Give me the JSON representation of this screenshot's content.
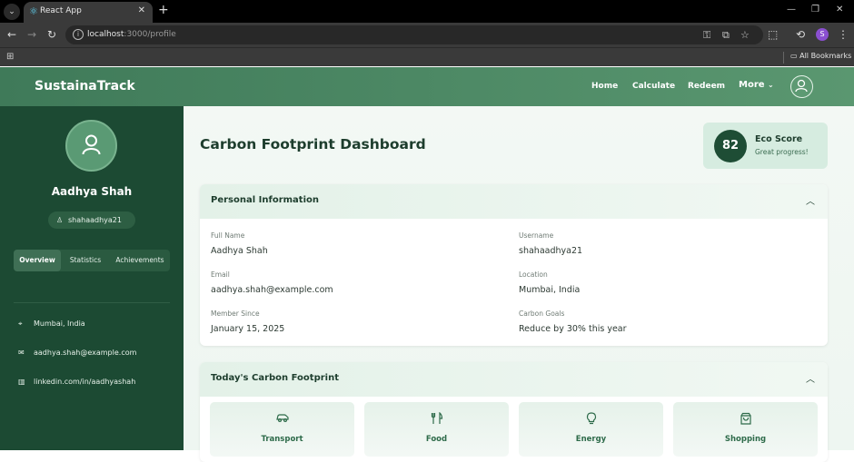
{
  "browser": {
    "tab_title": "React App",
    "url_host": "localhost",
    "url_path": ":3000/profile",
    "profile_initial": "S",
    "bookmarks_label": "All Bookmarks"
  },
  "header": {
    "brand": "SustainaTrack",
    "nav": [
      "Home",
      "Calculate",
      "Redeem"
    ],
    "more_label": "More"
  },
  "sidebar": {
    "name": "Aadhya Shah",
    "username": "shahaadhya21",
    "tabs": [
      "Overview",
      "Statistics",
      "Achievements"
    ],
    "active_tab": "Overview",
    "info": [
      {
        "icon": "location-icon",
        "text": "Mumbai, India"
      },
      {
        "icon": "mail-icon",
        "text": "aadhya.shah@example.com"
      },
      {
        "icon": "linkedin-icon",
        "text": "linkedin.com/in/aadhyashah"
      }
    ]
  },
  "main": {
    "title": "Carbon Footprint Dashboard",
    "eco_score": {
      "value": "82",
      "label": "Eco Score",
      "sub": "Great progress!"
    },
    "personal": {
      "title": "Personal Information",
      "fields": [
        {
          "label": "Full Name",
          "value": "Aadhya Shah"
        },
        {
          "label": "Username",
          "value": "shahaadhya21"
        },
        {
          "label": "Email",
          "value": "aadhya.shah@example.com"
        },
        {
          "label": "Location",
          "value": "Mumbai, India"
        },
        {
          "label": "Member Since",
          "value": "January 15, 2025"
        },
        {
          "label": "Carbon Goals",
          "value": "Reduce by 30% this year"
        }
      ]
    },
    "today": {
      "title": "Today's Carbon Footprint",
      "categories": [
        {
          "icon": "car-icon",
          "label": "Transport"
        },
        {
          "icon": "utensils-icon",
          "label": "Food"
        },
        {
          "icon": "lightbulb-icon",
          "label": "Energy"
        },
        {
          "icon": "shopping-bag-icon",
          "label": "Shopping"
        }
      ]
    }
  }
}
